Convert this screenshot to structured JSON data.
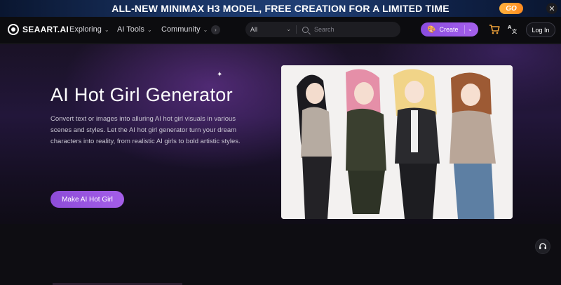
{
  "promo": {
    "text": "ALL-NEW MINIMAX H3 MODEL, FREE CREATION FOR A LIMITED TIME",
    "go_label": "GO",
    "close_icon": "close-icon"
  },
  "nav": {
    "logo_text": "SEAART.AI",
    "items": [
      {
        "label": "Exploring"
      },
      {
        "label": "AI Tools"
      },
      {
        "label": "Community"
      }
    ],
    "search": {
      "select_value": "All",
      "placeholder": "Search"
    },
    "create_label": "Create",
    "login_label": "Log In",
    "icons": [
      "logo-icon",
      "chevron-down-icon",
      "chevron-right-icon",
      "search-icon",
      "palette-icon",
      "cart-icon",
      "translate-icon",
      "headset-icon",
      "sparkle-icon"
    ]
  },
  "hero": {
    "title": "AI Hot Girl Generator",
    "description": "Convert text or images into alluring AI hot girl visuals in various scenes and styles. Let the AI hot girl generator turn your dream characters into reality, from realistic AI girls to bold artistic styles.",
    "cta_label": "Make AI Hot Girl"
  },
  "colors": {
    "accent": "#a05ee8",
    "promo_go": "#ff9a2a",
    "cart": "#f2a33a",
    "background": "#0e0d12"
  }
}
